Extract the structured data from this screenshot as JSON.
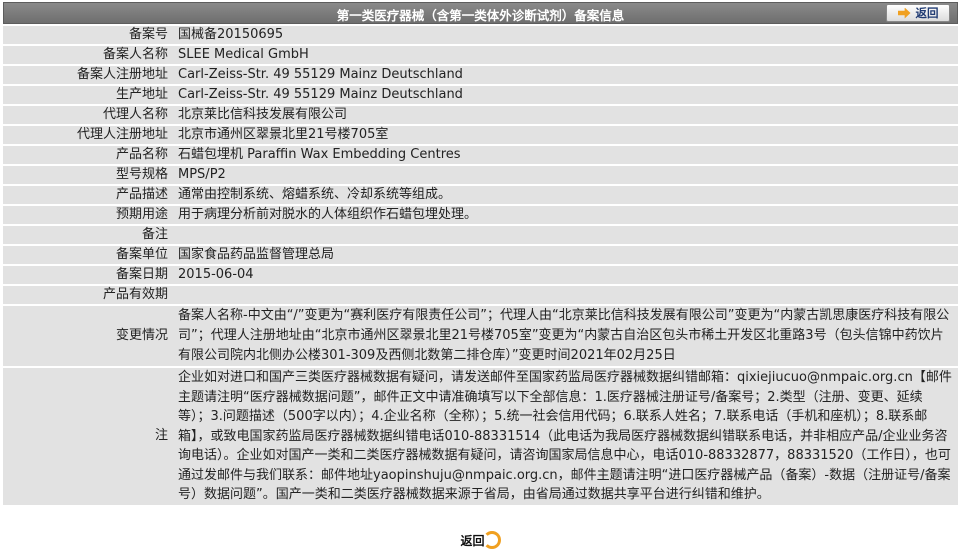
{
  "header": {
    "title": "第一类医疗器械（含第一类体外诊断试剂）备案信息",
    "back_label": "返回"
  },
  "rows": [
    {
      "label": "备案号",
      "value": "国械备20150695"
    },
    {
      "label": "备案人名称",
      "value": "SLEE Medical GmbH"
    },
    {
      "label": "备案人注册地址",
      "value": "Carl-Zeiss-Str. 49 55129 Mainz Deutschland"
    },
    {
      "label": "生产地址",
      "value": "Carl-Zeiss-Str. 49 55129 Mainz Deutschland"
    },
    {
      "label": "代理人名称",
      "value": "北京莱比信科技发展有限公司"
    },
    {
      "label": "代理人注册地址",
      "value": "北京市通州区翠景北里21号楼705室"
    },
    {
      "label": "产品名称",
      "value": "石蜡包埋机 Paraffin Wax Embedding Centres"
    },
    {
      "label": "型号规格",
      "value": "MPS/P2"
    },
    {
      "label": "产品描述",
      "value": "通常由控制系统、熔蜡系统、冷却系统等组成。"
    },
    {
      "label": "预期用途",
      "value": "用于病理分析前对脱水的人体组织作石蜡包埋处理。"
    },
    {
      "label": "备注",
      "value": ""
    },
    {
      "label": "备案单位",
      "value": "国家食品药品监督管理总局"
    },
    {
      "label": "备案日期",
      "value": "2015-06-04"
    },
    {
      "label": "产品有效期",
      "value": ""
    },
    {
      "label": "变更情况",
      "value": "备案人名称-中文由“/”变更为“赛利医疗有限责任公司”；代理人由“北京莱比信科技发展有限公司”变更为“内蒙古凯思康医疗科技有限公司”；代理人注册地址由“北京市通州区翠景北里21号楼705室”变更为“内蒙古自治区包头市稀土开发区北重路3号（包头信锦中药饮片有限公司院内北侧办公楼301-309及西侧北数第二排仓库）”变更时间2021年02月25日"
    },
    {
      "label": "注",
      "value": "企业如对进口和国产三类医疗器械数据有疑问，请发送邮件至国家药监局医疗器械数据纠错邮箱：qixiejiucuo@nmpaic.org.cn【邮件主题请注明“医疗器械数据问题”，邮件正文中请准确填写以下全部信息：1.医疗器械注册证号/备案号；2.类型（注册、变更、延续等）；3.问题描述（500字以内）；4.企业名称（全称）；5.统一社会信用代码；6.联系人姓名；7.联系电话（手机和座机）；8.联系邮箱】，或致电国家药监局医疗器械数据纠错电话010-88331514（此电话为我局医疗器械数据纠错联系电话，并非相应产品/企业业务咨询电话）。企业如对国产一类和二类医疗器械数据有疑问，请咨询国家局信息中心，电话010-88332877，88331520（工作日），也可通过发邮件与我们联系：邮件地址yaopinshuju@nmpaic.org.cn，邮件主题请注明“进口医疗器械产品（备案）-数据（注册证号/备案号）数据问题”。国产一类和二类医疗器械数据来源于省局，由省局通过数据共享平台进行纠错和维护。"
    }
  ],
  "footer": {
    "back_label": "返回"
  }
}
